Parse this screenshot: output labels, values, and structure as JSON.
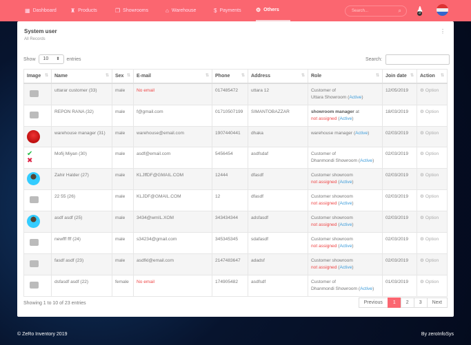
{
  "nav": {
    "items": [
      {
        "label": "Dashboard",
        "icon": "dashboard-icon"
      },
      {
        "label": "Products",
        "icon": "basket-icon"
      },
      {
        "label": "Showrooms",
        "icon": "copy-icon"
      },
      {
        "label": "Warehouse",
        "icon": "home-icon"
      },
      {
        "label": "Payments",
        "icon": "dollar-icon"
      },
      {
        "label": "Others",
        "icon": "settings-icon",
        "active": true
      }
    ],
    "search_placeholder": "Search...",
    "notification_count": "3"
  },
  "card": {
    "title": "System user",
    "subtitle": "All Records"
  },
  "controls": {
    "show": "Show",
    "entries_value": "10",
    "entries": "entries",
    "search": "Search:"
  },
  "table": {
    "columns": [
      "Image",
      "Name",
      "Sex",
      "E-mail",
      "Phone",
      "Address",
      "Role",
      "Join date",
      "Action"
    ],
    "rows": [
      {
        "image": "placeholder",
        "name": "uttarar customer (33)",
        "sex": "male",
        "email": "No email",
        "email_missing": true,
        "phone": "017485472",
        "address": "uttara 12",
        "role_line1": "Customer of",
        "role_line1_bold": false,
        "role_line2": "Uttara Showroom",
        "role_line2_red": false,
        "status": "Active",
        "join": "12/05/2019",
        "action": "Option"
      },
      {
        "image": "placeholder",
        "name": "REPON RANA (32)",
        "sex": "male",
        "email": "f@gmail.com",
        "phone": "01710507199",
        "address": "SIMANTOBAZZAR",
        "role_line1": "showroom manager",
        "role_line1_bold": true,
        "role_line1_suffix": " at",
        "role_line2": "not assigned",
        "role_line2_red": true,
        "status": "Active",
        "join": "18/03/2019",
        "action": "Option"
      },
      {
        "image": "logo",
        "name": "warehouse manager (31)",
        "sex": "male",
        "email": "warehouse@email.com",
        "phone": "1907440441",
        "address": "dhaka",
        "role_line1": "warehouse manager",
        "role_inline": true,
        "status": "Active",
        "join": "02/03/2019",
        "action": "Option"
      },
      {
        "image": "check-cross",
        "name": "Mofij Miyan (30)",
        "sex": "male",
        "email": "asdf@email.com",
        "phone": "5456454",
        "address": "asdfsdaf",
        "role_line1": "Customer of",
        "role_line2": "Dhanmondi Showroom",
        "role_line2_red": false,
        "status": "Active",
        "join": "02/03/2019",
        "action": "Option"
      },
      {
        "image": "person",
        "name": "Zahir Halder (27)",
        "sex": "male",
        "email": "KLJffDF@GMAIL.COM",
        "phone": "12444",
        "address": "dfasdf",
        "role_line1": "Customer showroom",
        "role_line2": "not assigned",
        "role_line2_red": true,
        "status": "Active",
        "join": "02/03/2019",
        "action": "Option"
      },
      {
        "image": "placeholder",
        "name": "22 55 (26)",
        "sex": "male",
        "email": "KLJDF@GMAIL.COM",
        "phone": "12",
        "address": "dfasdf",
        "role_line1": "Customer showroom",
        "role_line2": "not assigned",
        "role_line2_red": true,
        "status": "Active",
        "join": "02/03/2019",
        "action": "Option"
      },
      {
        "image": "person",
        "name": "asdf asdf (25)",
        "sex": "male",
        "email": "3434@wmIL.XOM",
        "phone": "343434344",
        "address": "adsfasdf",
        "role_line1": "Customer showroom",
        "role_line2": "not assigned",
        "role_line2_red": true,
        "status": "Active",
        "join": "02/03/2019",
        "action": "Option"
      },
      {
        "image": "placeholder",
        "name": "newfff fff (24)",
        "sex": "male",
        "email": "s34234@gmail.com",
        "phone": "345345345",
        "address": "sdafasdf",
        "role_line1": "Customer showroom",
        "role_line2": "not assigned",
        "role_line2_red": true,
        "status": "Active",
        "join": "02/03/2019",
        "action": "Option"
      },
      {
        "image": "placeholder",
        "name": "fasdf asdf (23)",
        "sex": "male",
        "email": "asdfkl@email.com",
        "phone": "2147483647",
        "address": "adadsf",
        "role_line1": "Customer showroom",
        "role_line2": "not assigned",
        "role_line2_red": true,
        "status": "Active",
        "join": "02/03/2019",
        "action": "Option"
      },
      {
        "image": "placeholder",
        "name": "dsfasdf asdf (22)",
        "sex": "female",
        "email": "No email",
        "email_missing": true,
        "phone": "174905482",
        "address": "asdfsdf",
        "role_line1": "Customer of",
        "role_line2": "Dhanmondi Showroom",
        "role_line2_red": false,
        "status": "Active",
        "join": "01/03/2019",
        "action": "Option"
      }
    ]
  },
  "pagination": {
    "info": "Showing 1 to 10 of 23 entries",
    "previous": "Previous",
    "pages": [
      "1",
      "2",
      "3"
    ],
    "current": "1",
    "next": "Next"
  },
  "footer": {
    "left": "© ZeRo Inventory 2019",
    "right": "By zeroInfoSys"
  },
  "colors": {
    "accent": "#fb6670",
    "link": "#3a9ad9",
    "error": "#e44444"
  }
}
